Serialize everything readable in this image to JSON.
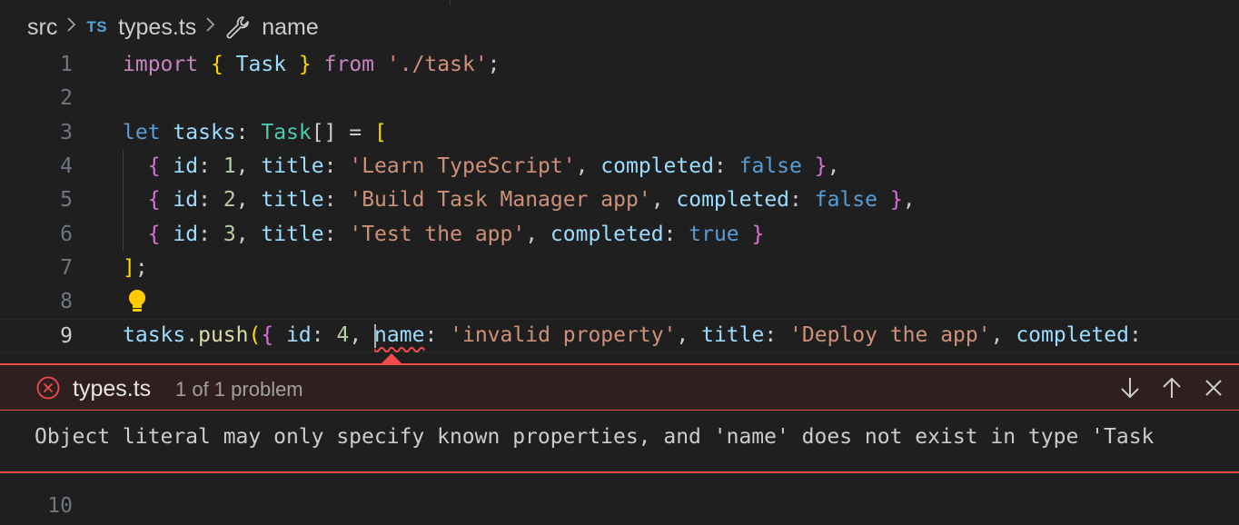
{
  "breadcrumb": {
    "folder": "src",
    "file_badge": "TS",
    "file": "types.ts",
    "symbol": "name"
  },
  "editor": {
    "lines": [
      {
        "number": "1",
        "tokens": [
          {
            "t": "import",
            "c": "kw"
          },
          {
            "t": " ",
            "c": "pu"
          },
          {
            "t": "{",
            "c": "br1"
          },
          {
            "t": " ",
            "c": "pu"
          },
          {
            "t": "Task",
            "c": "id"
          },
          {
            "t": " ",
            "c": "pu"
          },
          {
            "t": "}",
            "c": "br1"
          },
          {
            "t": " ",
            "c": "pu"
          },
          {
            "t": "from",
            "c": "kw"
          },
          {
            "t": " ",
            "c": "pu"
          },
          {
            "t": "'./task'",
            "c": "st"
          },
          {
            "t": ";",
            "c": "pu"
          }
        ]
      },
      {
        "number": "2",
        "tokens": []
      },
      {
        "number": "3",
        "tokens": [
          {
            "t": "let",
            "c": "kwb"
          },
          {
            "t": " ",
            "c": "pu"
          },
          {
            "t": "tasks",
            "c": "id"
          },
          {
            "t": ": ",
            "c": "pu"
          },
          {
            "t": "Task",
            "c": "ty"
          },
          {
            "t": "[]",
            "c": "pu"
          },
          {
            "t": " = ",
            "c": "pu"
          },
          {
            "t": "[",
            "c": "br1"
          }
        ]
      },
      {
        "number": "4",
        "tokens": [
          {
            "t": "  ",
            "c": "pu"
          },
          {
            "t": "{",
            "c": "br2"
          },
          {
            "t": " ",
            "c": "pu"
          },
          {
            "t": "id",
            "c": "id"
          },
          {
            "t": ": ",
            "c": "pu"
          },
          {
            "t": "1",
            "c": "nu"
          },
          {
            "t": ", ",
            "c": "pu"
          },
          {
            "t": "title",
            "c": "id"
          },
          {
            "t": ": ",
            "c": "pu"
          },
          {
            "t": "'Learn TypeScript'",
            "c": "st"
          },
          {
            "t": ", ",
            "c": "pu"
          },
          {
            "t": "completed",
            "c": "id"
          },
          {
            "t": ": ",
            "c": "pu"
          },
          {
            "t": "false",
            "c": "kwb"
          },
          {
            "t": " ",
            "c": "pu"
          },
          {
            "t": "}",
            "c": "br2"
          },
          {
            "t": ",",
            "c": "pu"
          }
        ]
      },
      {
        "number": "5",
        "tokens": [
          {
            "t": "  ",
            "c": "pu"
          },
          {
            "t": "{",
            "c": "br2"
          },
          {
            "t": " ",
            "c": "pu"
          },
          {
            "t": "id",
            "c": "id"
          },
          {
            "t": ": ",
            "c": "pu"
          },
          {
            "t": "2",
            "c": "nu"
          },
          {
            "t": ", ",
            "c": "pu"
          },
          {
            "t": "title",
            "c": "id"
          },
          {
            "t": ": ",
            "c": "pu"
          },
          {
            "t": "'Build Task Manager app'",
            "c": "st"
          },
          {
            "t": ", ",
            "c": "pu"
          },
          {
            "t": "completed",
            "c": "id"
          },
          {
            "t": ": ",
            "c": "pu"
          },
          {
            "t": "false",
            "c": "kwb"
          },
          {
            "t": " ",
            "c": "pu"
          },
          {
            "t": "}",
            "c": "br2"
          },
          {
            "t": ",",
            "c": "pu"
          }
        ]
      },
      {
        "number": "6",
        "tokens": [
          {
            "t": "  ",
            "c": "pu"
          },
          {
            "t": "{",
            "c": "br2"
          },
          {
            "t": " ",
            "c": "pu"
          },
          {
            "t": "id",
            "c": "id"
          },
          {
            "t": ": ",
            "c": "pu"
          },
          {
            "t": "3",
            "c": "nu"
          },
          {
            "t": ", ",
            "c": "pu"
          },
          {
            "t": "title",
            "c": "id"
          },
          {
            "t": ": ",
            "c": "pu"
          },
          {
            "t": "'Test the app'",
            "c": "st"
          },
          {
            "t": ", ",
            "c": "pu"
          },
          {
            "t": "completed",
            "c": "id"
          },
          {
            "t": ": ",
            "c": "pu"
          },
          {
            "t": "true",
            "c": "kwb"
          },
          {
            "t": " ",
            "c": "pu"
          },
          {
            "t": "}",
            "c": "br2"
          }
        ]
      },
      {
        "number": "7",
        "tokens": [
          {
            "t": "]",
            "c": "br1"
          },
          {
            "t": ";",
            "c": "pu"
          }
        ]
      },
      {
        "number": "8",
        "tokens": []
      },
      {
        "number": "9",
        "current": true,
        "tokens": [
          {
            "t": "tasks",
            "c": "id"
          },
          {
            "t": ".",
            "c": "pu"
          },
          {
            "t": "push",
            "c": "fn"
          },
          {
            "t": "(",
            "c": "br1"
          },
          {
            "t": "{",
            "c": "br2"
          },
          {
            "t": " ",
            "c": "pu"
          },
          {
            "t": "id",
            "c": "id"
          },
          {
            "t": ": ",
            "c": "pu"
          },
          {
            "t": "4",
            "c": "nu"
          },
          {
            "t": ", ",
            "c": "pu"
          },
          {
            "t": "CURSOR",
            "c": "cursor"
          },
          {
            "t": "name",
            "c": "id squig"
          },
          {
            "t": ": ",
            "c": "pu"
          },
          {
            "t": "'invalid property'",
            "c": "st"
          },
          {
            "t": ", ",
            "c": "pu"
          },
          {
            "t": "title",
            "c": "id"
          },
          {
            "t": ": ",
            "c": "pu"
          },
          {
            "t": "'Deploy the app'",
            "c": "st"
          },
          {
            "t": ", ",
            "c": "pu"
          },
          {
            "t": "completed",
            "c": "id"
          },
          {
            "t": ":",
            "c": "pu"
          }
        ]
      }
    ],
    "after_peek_line_number": "10"
  },
  "problem_peek": {
    "file": "types.ts",
    "count": "1 of 1 problem",
    "message": "Object literal may only specify known properties, and 'name' does not exist in type 'Task"
  },
  "colors": {
    "error": "#f14c4c",
    "background": "#1f1f1f",
    "lightbulb": "#ffcc00"
  }
}
